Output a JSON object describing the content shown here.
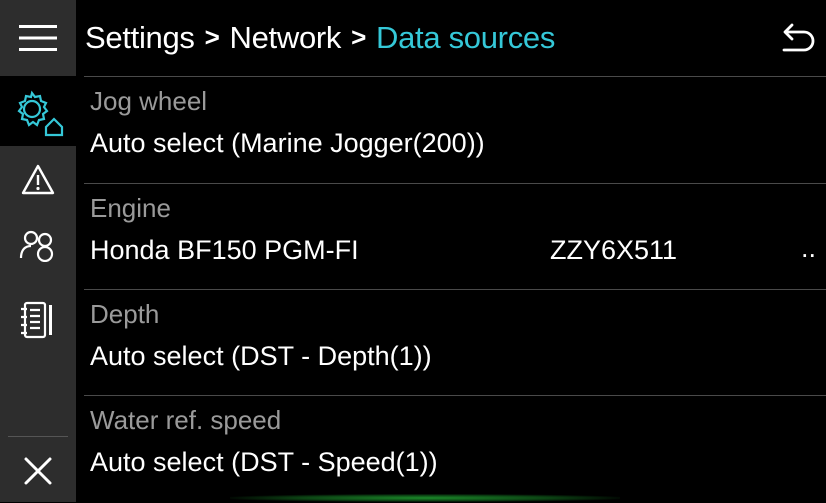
{
  "header": {
    "breadcrumb": [
      "Settings",
      "Network",
      "Data sources"
    ],
    "separator": ">"
  },
  "sidebar": {
    "items": [
      {
        "icon": "menu-icon"
      },
      {
        "icon": "settings-home-icon",
        "active": true
      },
      {
        "icon": "alert-icon"
      },
      {
        "icon": "contacts-icon"
      },
      {
        "icon": "logbook-icon"
      },
      {
        "icon": "close-icon"
      }
    ]
  },
  "rows": [
    {
      "label": "Jog wheel",
      "value": "Auto select (Marine Jogger(200))"
    },
    {
      "label": "Engine",
      "value": "Honda BF150 PGM-FI",
      "serial": "ZZY6X511",
      "more": ".."
    },
    {
      "label": "Depth",
      "value": "Auto select (DST - Depth(1))"
    },
    {
      "label": "Water ref. speed",
      "value": "Auto select (DST - Speed(1))"
    }
  ],
  "colors": {
    "accent": "#35c8d8",
    "sidebar_bg": "#2d2d2d",
    "label_text": "#9a9a9a",
    "background": "#000000"
  }
}
